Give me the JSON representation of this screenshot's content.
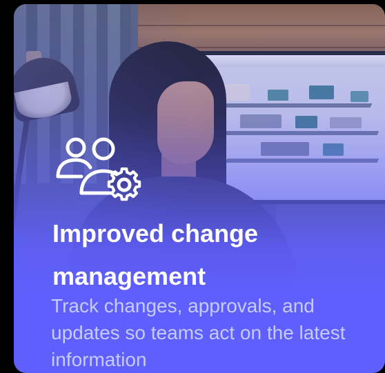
{
  "card": {
    "icon": "users-gear-icon",
    "title": "Improved change management",
    "description": "Track changes, approvals, and updates so teams act on the latest information",
    "accent_color": "#5f5ffd",
    "description_color": "#c7ccff",
    "title_color": "#ffffff"
  }
}
